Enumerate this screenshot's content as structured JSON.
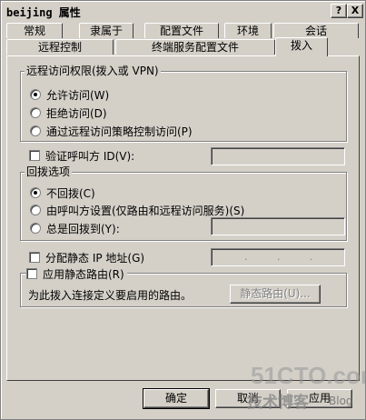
{
  "window": {
    "title": "beijing 属性",
    "help_label": "?",
    "close_label": "X"
  },
  "tabs_row1": [
    {
      "label": "常规"
    },
    {
      "label": "隶属于"
    },
    {
      "label": "配置文件"
    },
    {
      "label": "环境"
    },
    {
      "label": "会话"
    }
  ],
  "tabs_row2": [
    {
      "label": "远程控制"
    },
    {
      "label": "终端服务配置文件"
    },
    {
      "label": "拨入",
      "active": true
    }
  ],
  "remote_access": {
    "group_label": "远程访问权限(拨入或 VPN)",
    "options": [
      {
        "label": "允许访问(W)",
        "selected": true
      },
      {
        "label": "拒绝访问(D)",
        "selected": false
      },
      {
        "label": "通过远程访问策略控制访问(P)",
        "selected": false
      }
    ]
  },
  "verify_caller": {
    "label": "验证呼叫方 ID(V):",
    "checked": false,
    "value": ""
  },
  "callback": {
    "group_label": "回拨选项",
    "options": [
      {
        "label": "不回拨(C)",
        "selected": true
      },
      {
        "label": "由呼叫方设置(仅路由和远程访问服务)(S)",
        "selected": false
      },
      {
        "label": "总是回拨到(Y):",
        "selected": false
      }
    ],
    "always_value": ""
  },
  "static_ip": {
    "label": "分配静态 IP 地址(G)",
    "checked": false,
    "ip_separators": [
      ".",
      ".",
      "."
    ]
  },
  "static_routes": {
    "label": "应用静态路由(R)",
    "checked": false,
    "description": "为此拨入连接定义要启用的路由。",
    "button_label": "静态路由(U)..."
  },
  "buttons": {
    "ok": "确定",
    "cancel": "取消",
    "apply": "应用"
  },
  "watermark": {
    "site": "51CTO.com",
    "blog_cn": "技术博客",
    "blog_en": "Blog"
  }
}
